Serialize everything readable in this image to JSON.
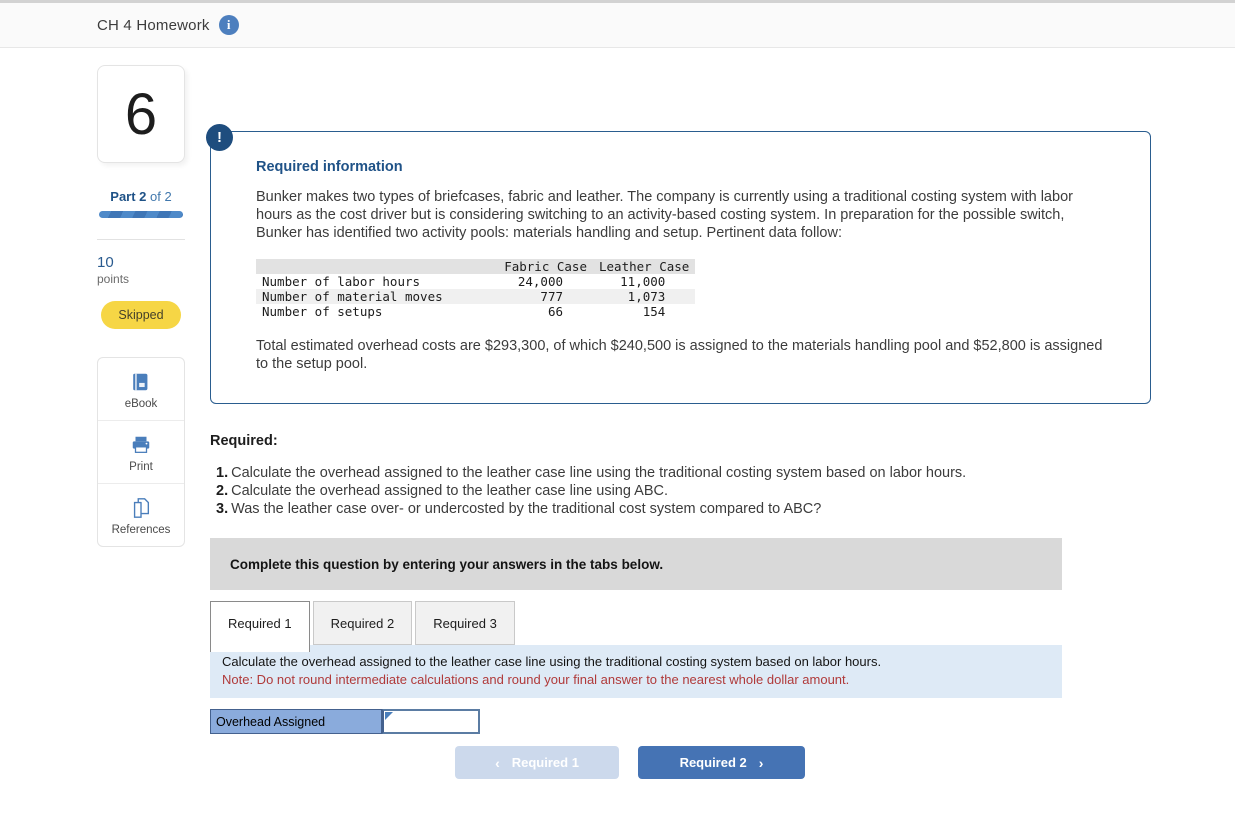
{
  "header": {
    "title": "CH 4 Homework",
    "info_icon": "i"
  },
  "sidebar": {
    "question_number": "6",
    "part_bold": "Part 2",
    "part_rest": " of 2",
    "points_value": "10",
    "points_label": "points",
    "status": "Skipped",
    "tools": {
      "ebook": "eBook",
      "print": "Print",
      "references": "References"
    }
  },
  "question": {
    "alert_icon": "!",
    "info_heading": "Required information",
    "intro": "Bunker makes two types of briefcases, fabric and leather. The company is currently using a traditional costing system with labor hours as the cost driver but is considering switching to an activity-based costing system. In preparation for the possible switch, Bunker has identified two activity pools: materials handling and setup. Pertinent data follow:",
    "table": {
      "col_headers": [
        "Fabric Case",
        "Leather Case"
      ],
      "rows": [
        {
          "label": "Number of labor hours",
          "fabric": "24,000",
          "leather": "11,000"
        },
        {
          "label": "Number of material moves",
          "fabric": "777",
          "leather": "1,073"
        },
        {
          "label": "Number of setups",
          "fabric": "66",
          "leather": "154"
        }
      ]
    },
    "totals": "Total estimated overhead costs are $293,300, of which $240,500 is assigned to the materials handling pool and $52,800 is assigned to the setup pool.",
    "required_label": "Required:",
    "required_items": [
      {
        "num": "1.",
        "text": "Calculate the overhead assigned to the leather case line using the traditional costing system based on labor hours."
      },
      {
        "num": "2.",
        "text": "Calculate the overhead assigned to the leather case line using ABC."
      },
      {
        "num": "3.",
        "text": "Was the leather case over- or undercosted by the traditional cost system compared to ABC?"
      }
    ]
  },
  "answer_panel": {
    "banner": "Complete this question by entering your answers in the tabs below.",
    "tabs": [
      {
        "label": "Required 1"
      },
      {
        "label": "Required 2"
      },
      {
        "label": "Required 3"
      }
    ],
    "instruction": "Calculate the overhead assigned to the leather case line using the traditional costing system based on labor hours.",
    "note": "Note: Do not round intermediate calculations and round your final answer to the nearest whole dollar amount.",
    "answer_label": "Overhead Assigned",
    "answer_value": "",
    "nav": {
      "prev_chevron": "‹",
      "prev_label": "Required 1",
      "next_label": "Required 2",
      "next_chevron": "›"
    }
  }
}
